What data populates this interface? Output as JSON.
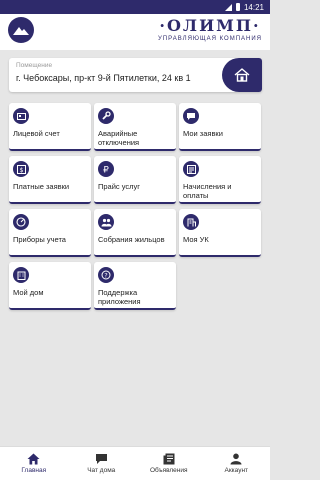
{
  "status_bar": {
    "time": "14:21"
  },
  "brand": {
    "name": "·ОЛИМП·",
    "subtitle": "УПРАВЛЯЮЩАЯ КОМПАНИЯ"
  },
  "address": {
    "label": "Помещение",
    "value": "г. Чебоксары, пр-кт 9-й Пятилетки, 24 кв 1"
  },
  "tiles": [
    {
      "label": "Лицевой счет",
      "icon": "id-card-icon"
    },
    {
      "label": "Аварийные отключения",
      "icon": "wrench-icon"
    },
    {
      "label": "Мои заявки",
      "icon": "chat-icon"
    },
    {
      "label": "Платные заявки",
      "icon": "paid-icon"
    },
    {
      "label": "Прайс услуг",
      "icon": "ruble-icon"
    },
    {
      "label": "Начисления и оплаты",
      "icon": "receipt-icon"
    },
    {
      "label": "Приборы учета",
      "icon": "gauge-icon"
    },
    {
      "label": "Собрания жильцов",
      "icon": "people-icon"
    },
    {
      "label": "Моя УК",
      "icon": "building-icon"
    },
    {
      "label": "Мой дом",
      "icon": "house-icon"
    },
    {
      "label": "Поддержка приложения",
      "icon": "help-icon"
    }
  ],
  "nav": [
    {
      "label": "Главная",
      "icon": "home-icon",
      "active": true
    },
    {
      "label": "Чат дома",
      "icon": "chat-icon"
    },
    {
      "label": "Объявления",
      "icon": "news-icon"
    },
    {
      "label": "Аккаунт",
      "icon": "account-icon"
    }
  ],
  "colors": {
    "primary": "#2e2a6b",
    "background": "#e6e6e6",
    "surface": "#ffffff"
  }
}
